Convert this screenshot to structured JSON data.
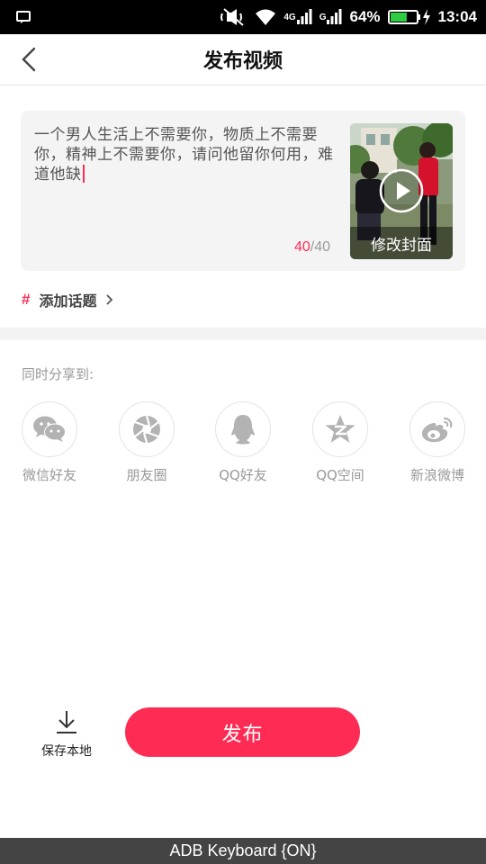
{
  "status_bar": {
    "battery_pct": "64%",
    "time": "13:04",
    "net_4g": "4G",
    "net_g": "G",
    "battery_level": 0.64
  },
  "header": {
    "title": "发布视频"
  },
  "composer": {
    "caption": "一个男人生活上不需要你，物质上不需要你，精神上不需要你，请问他留你何用，难道他缺",
    "count_used": "40",
    "count_total": "/40",
    "cover_label": "修改封面"
  },
  "topic": {
    "hash": "#",
    "label": "添加话题"
  },
  "share": {
    "label": "同时分享到:",
    "items": [
      {
        "label": "微信好友",
        "icon": "wechat-icon"
      },
      {
        "label": "朋友圈",
        "icon": "moments-icon"
      },
      {
        "label": "QQ好友",
        "icon": "qq-icon"
      },
      {
        "label": "QQ空间",
        "icon": "qzone-icon"
      },
      {
        "label": "新浪微博",
        "icon": "weibo-icon"
      }
    ]
  },
  "actions": {
    "save_local": "保存本地",
    "publish": "发布"
  },
  "keyboard": {
    "status": "ADB Keyboard {ON}"
  },
  "colors": {
    "accent": "#fe2c55",
    "icon_gray": "#b3b3b3"
  }
}
